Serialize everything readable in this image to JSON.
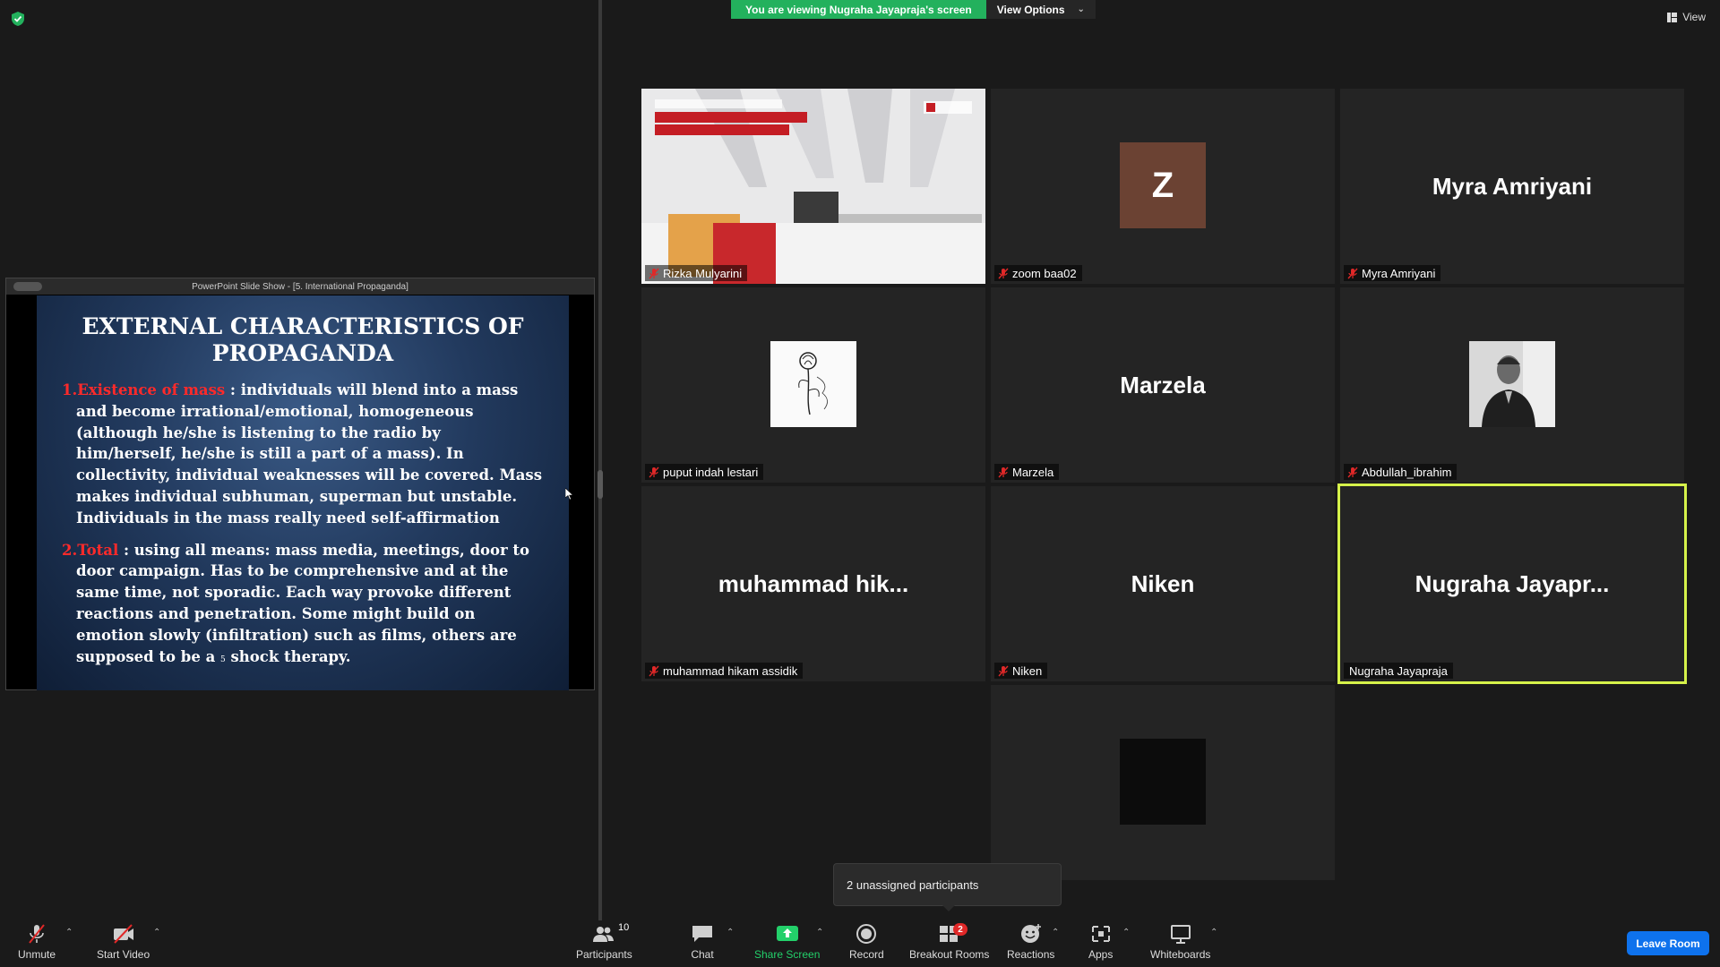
{
  "banner": {
    "viewing_text": "You are viewing Nugraha Jayapraja's screen",
    "view_options_label": "View Options"
  },
  "view_button_label": "View",
  "shared_screen": {
    "window_title": "PowerPoint Slide Show - [5. International Propaganda]",
    "slide": {
      "title": "EXTERNAL CHARACTERISTICS OF PROPAGANDA",
      "point1_number": "1.",
      "point1_highlight": "Existence of mass",
      "point1_text": " : individuals will blend into a mass and become irrational/emotional, homogeneous  (although he/she is listening to the radio by him/herself, he/she is still a part of a mass). In collectivity, individual weaknesses will be covered. Mass makes individual subhuman, superman but unstable. Individuals in the mass really need self-affirmation",
      "point2_number": "2.",
      "point2_highlight": "Total",
      "point2_text": " : using all means: mass media, meetings, door to door campaign. Has to be comprehensive and at the same time, not sporadic. Each way provoke different reactions and penetration. Some might build on emotion slowly (infiltration) such as films, others are supposed to be a",
      "slide_number": "5",
      "point2_tail": " shock therapy."
    }
  },
  "participants": [
    {
      "name": "Rizka Mulyarini",
      "muted": true
    },
    {
      "name": "zoom baa02",
      "muted": true,
      "avatar_letter": "Z",
      "avatar_color": "#6b4233"
    },
    {
      "name": "Myra Amriyani",
      "muted": true,
      "display_name": "Myra Amriyani"
    },
    {
      "name": "puput indah lestari",
      "muted": true
    },
    {
      "name": "Marzela",
      "muted": true,
      "display_name": "Marzela"
    },
    {
      "name": "Abdullah_ibrahim",
      "muted": true
    },
    {
      "name": "muhammad hikam assidik",
      "muted": true,
      "display_name": "muhammad  hik..."
    },
    {
      "name": "Niken",
      "muted": true,
      "display_name": "Niken"
    },
    {
      "name": "Nugraha Jayapraja",
      "muted": false,
      "display_name": "Nugraha  Jayapr...",
      "active_speaker": true
    }
  ],
  "popup": {
    "text": "2 unassigned participants"
  },
  "toolbar": {
    "unmute": "Unmute",
    "start_video": "Start Video",
    "participants": "Participants",
    "participants_count": "10",
    "chat": "Chat",
    "share_screen": "Share Screen",
    "record": "Record",
    "breakout_rooms": "Breakout Rooms",
    "breakout_badge": "2",
    "reactions": "Reactions",
    "apps": "Apps",
    "whiteboards": "Whiteboards",
    "leave_room": "Leave Room"
  },
  "colors": {
    "banner_green": "#23b15d",
    "active_speaker_border": "#d6f24a",
    "leave_blue": "#0e72ed",
    "mute_red": "#e02828",
    "slide_highlight": "#ff2a2a"
  }
}
